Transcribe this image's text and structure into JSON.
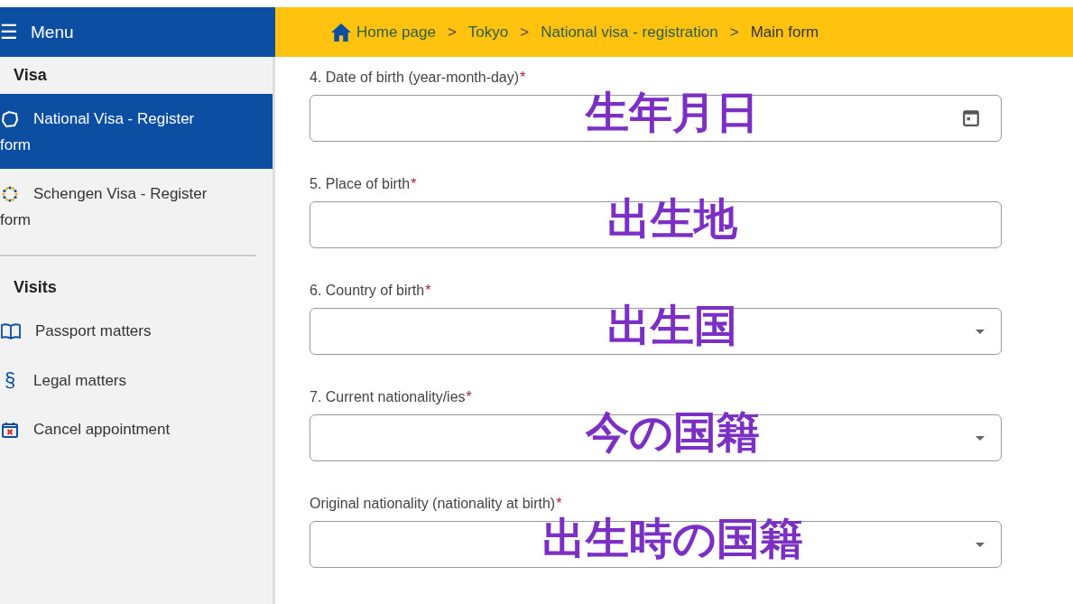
{
  "menu": {
    "icon": "☰",
    "title": "Menu"
  },
  "sidebar": {
    "sections": [
      {
        "heading": "Visa",
        "items": [
          {
            "label": "National Visa -  Register form",
            "kind": "map",
            "selected": true
          },
          {
            "label": "Schengen Visa -  Register form",
            "kind": "stars",
            "selected": false
          }
        ]
      },
      {
        "heading": "Visits",
        "items": [
          {
            "label": "Passport matters",
            "kind": "book",
            "selected": false
          },
          {
            "label": "Legal matters",
            "kind": "glyph",
            "glyph": "§",
            "selected": false
          },
          {
            "label": "Cancel appointment",
            "kind": "calendar-x",
            "selected": false
          }
        ]
      }
    ]
  },
  "breadcrumb": [
    {
      "label": "Home page",
      "kind": "home"
    },
    {
      "label": "Tokyo",
      "kind": "link"
    },
    {
      "label": "National visa - registration",
      "kind": "link"
    },
    {
      "label": "Main form",
      "kind": "current"
    }
  ],
  "breadcrumb_separator": ">",
  "required_mark": "*",
  "fields": [
    {
      "label": "4. Date of birth (year-month-day)",
      "required": true,
      "kind": "date",
      "annotation": "生年月日"
    },
    {
      "label": "5. Place of birth",
      "required": true,
      "kind": "text",
      "annotation": "出生地"
    },
    {
      "label": "6. Country of birth",
      "required": true,
      "kind": "select",
      "annotation": "出生国"
    },
    {
      "label": "7. Current nationality/ies",
      "required": true,
      "kind": "select",
      "annotation": "今の国籍"
    },
    {
      "label": "Original nationality (nationality at birth)",
      "required": true,
      "kind": "select",
      "annotation": "出生時の国籍"
    }
  ]
}
